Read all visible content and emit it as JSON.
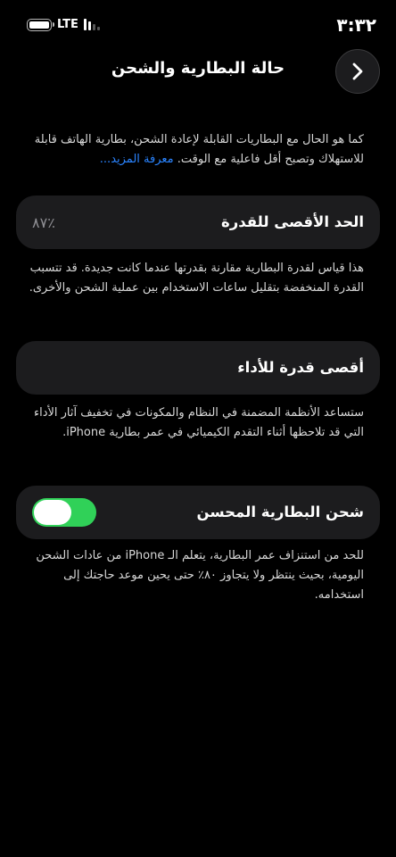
{
  "status_bar": {
    "time": "٣:٣٢",
    "network": "LTE"
  },
  "header": {
    "title": "حالة البطارية والشحن"
  },
  "intro": {
    "text": "كما هو الحال مع البطاريات القابلة لإعادة الشحن، بطارية الهاتف قابلة للاستهلاك وتصبح أقل فاعلية مع الوقت.",
    "link": "معرفة المزيد..."
  },
  "max_capacity": {
    "label": "الحد الأقصى للقدرة",
    "value": "٨٧٪",
    "description": "هذا قياس لقدرة البطارية مقارنة بقدرتها عندما كانت جديدة. قد تتسبب القدرة المنخفضة بتقليل ساعات الاستخدام بين عملية الشحن والأخرى."
  },
  "peak_performance": {
    "label": "أقصى قدرة للأداء",
    "description": "ستساعد الأنظمة المضمنة في النظام والمكونات في تخفيف آثار الأداء التي قد تلاحظها أثناء التقدم الكيميائي في عمر بطارية iPhone."
  },
  "optimized_charging": {
    "label": "شحن البطارية المحسن",
    "enabled": true,
    "description": "للحد من استنزاف عمر البطارية، يتعلم الـ iPhone من عادات الشحن اليومية، بحيث ينتظر ولا يتجاوز ٨٠٪ حتى يحين موعد حاجتك إلى استخدامه."
  },
  "colors": {
    "toggle_on": "#30d158",
    "link": "#2a84ff",
    "card": "#1c1c1e"
  }
}
